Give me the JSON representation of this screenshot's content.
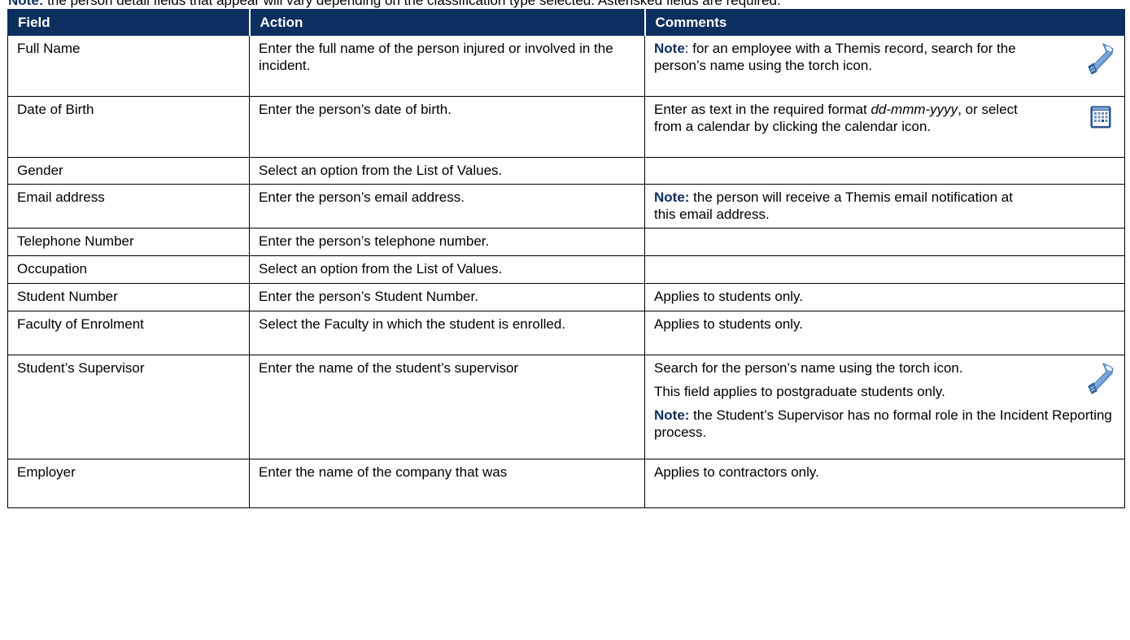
{
  "top_note": {
    "label": "Note:",
    "text": " the person detail fields that appear will vary depending on the classification type selected. Asterisked fields are required."
  },
  "table": {
    "headers": [
      "Field",
      "Action",
      "Comments"
    ],
    "rows": [
      {
        "field": "Full Name",
        "action": "Enter the full name of the person injured or involved in the incident.",
        "comment_note": "Note",
        "comment_text": ": for an employee with a Themis record, search for the person’s name using the torch icon.",
        "icon": "torch-icon"
      },
      {
        "field": "Date of Birth",
        "action": "Enter the person’s date of birth.",
        "comment_pre": "Enter as text in the required format ",
        "comment_format": "dd-mmm-yyyy",
        "comment_post": ", or select from a calendar by clicking the calendar icon.",
        "icon": "calendar-icon"
      },
      {
        "field": "Gender",
        "action": "Select an option from the List of Values."
      },
      {
        "field": "Email address",
        "action": "Enter the person’s email address.",
        "comment_note": "Note:",
        "comment_text": " the person will receive a Themis email notification at this email address."
      },
      {
        "field": "Telephone Number",
        "action": "Enter the person’s telephone number."
      },
      {
        "field": "Occupation",
        "action": "Select an option from the List of Values."
      },
      {
        "field": "Student Number",
        "action": "Enter the person’s Student Number.",
        "comment": "Applies to students only."
      },
      {
        "field": "Faculty of Enrolment",
        "action": "Select the Faculty in which the student is enrolled.",
        "comment": "Applies to students only."
      },
      {
        "field": "Student’s Supervisor",
        "action": "Enter the name of the student’s supervisor",
        "comment_p1": "Search for the person’s name using the torch icon.",
        "comment_p2": "This field applies to postgraduate students only.",
        "comment_note": "Note:",
        "comment_text": " the Student’s Supervisor has no formal role in the Incident Reporting process.",
        "icon": "torch-icon"
      },
      {
        "field": "Employer",
        "action": "Enter the name of the company that was",
        "comment": "Applies to contractors only."
      }
    ]
  },
  "colors": {
    "header_bg": "#0d2f5f",
    "note_label": "#0d2f5f"
  }
}
